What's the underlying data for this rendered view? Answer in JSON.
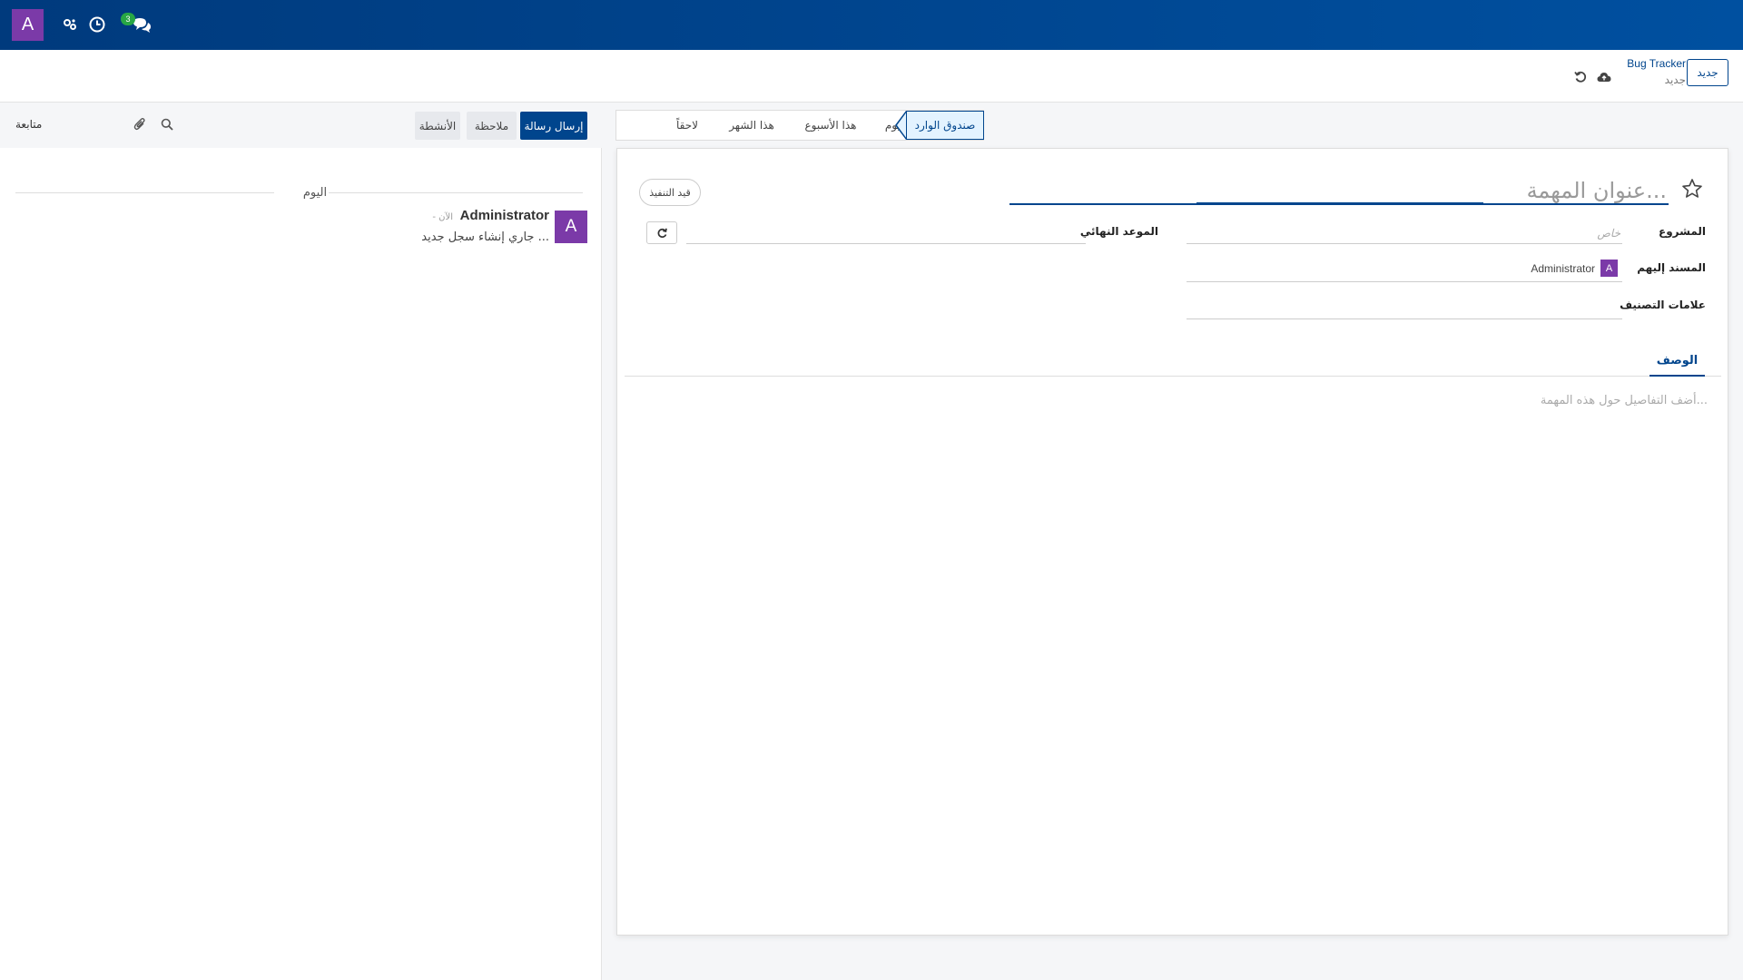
{
  "navbar": {
    "avatar_letter": "A",
    "messages_badge": "3",
    "colors": {
      "bar": "#00458d",
      "avatar": "#7b3aa8",
      "badge": "#28a745"
    }
  },
  "control_panel": {
    "new_button": "جديد",
    "breadcrumb_root": "Bug Tracker",
    "breadcrumb_current": "جديد"
  },
  "chatter": {
    "follow_label": "متابعة",
    "buttons": {
      "activities": "الأنشطة",
      "note": "ملاحظة",
      "send_message": "إرسال رسالة"
    },
    "day_separator": "اليوم",
    "messages": [
      {
        "avatar_letter": "A",
        "author": "Administrator",
        "time": "- الآن",
        "body": "جاري إنشاء سجل جديد ..."
      }
    ]
  },
  "status_bar": {
    "stages": [
      "لاحقاً",
      "هذا الشهر",
      "هذا الأسبوع",
      "اليوم",
      "صندوق الوارد"
    ],
    "active_stage": "صندوق الوارد"
  },
  "form": {
    "title_placeholder": "عنوان المهمة...",
    "state_badge": "قيد التنفيذ",
    "fields": {
      "project_label": "المشروع",
      "project_placeholder": "خاص",
      "assignees_label": "المسند إليهم",
      "assignee_name": "Administrator",
      "assignee_letter": "A",
      "tags_label": "علامات التصنيف",
      "deadline_label": "الموعد النهائي"
    },
    "tabs": {
      "description": "الوصف"
    },
    "description_placeholder": "أضف التفاصيل حول هذه المهمة..."
  }
}
